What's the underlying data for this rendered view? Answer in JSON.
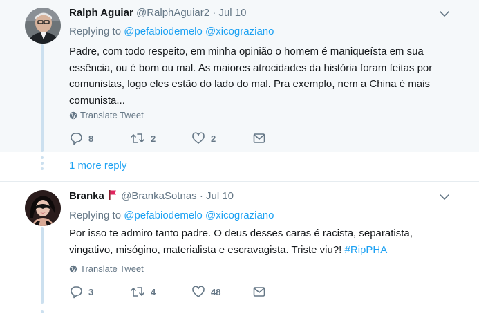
{
  "tweets": [
    {
      "author_name": "Ralph Aguiar",
      "author_handle": "@RalphAguiar2",
      "separator": "·",
      "date": "Jul 10",
      "replying_label": "Replying to",
      "mentions": [
        "@pefabiodemelo",
        "@xicograziano"
      ],
      "text_lines": [
        "Padre, com todo respeito, em minha opinião o homem é maniqueísta em sua",
        "essência, ou é bom ou mal. As maiores atrocidades da história foram feitas por",
        "comunistas,  logo eles estão do lado do mal. Pra exemplo, nem a China é mais",
        "comunista..."
      ],
      "translate_label": "Translate Tweet",
      "reply_count": "8",
      "retweet_count": "2",
      "like_count": "2"
    },
    {
      "author_name": "Branka",
      "author_handle": "@BrankaSotnas",
      "separator": "·",
      "date": "Jul 10",
      "replying_label": "Replying to",
      "mentions": [
        "@pefabiodemelo",
        "@xicograziano"
      ],
      "text_lines": [
        "Por isso te admiro tanto padre. O deus desses caras é racista, separatista,",
        "vingativo, misógino, materialista e escravagista. Triste viu?! "
      ],
      "hashtag": "#RipPHA",
      "translate_label": "Translate Tweet",
      "reply_count": "3",
      "retweet_count": "4",
      "like_count": "48"
    }
  ],
  "more_reply_label": "1 more reply",
  "colors": {
    "link": "#1da1f2",
    "muted": "#657786",
    "thread_line": "#cce0ef",
    "flag": "#e0245e",
    "tweet_bg_highlight": "#f5f8fa"
  },
  "icons": [
    "reply-icon",
    "retweet-icon",
    "like-icon",
    "message-icon",
    "globe-icon",
    "chevron-down-icon",
    "flag-icon"
  ]
}
